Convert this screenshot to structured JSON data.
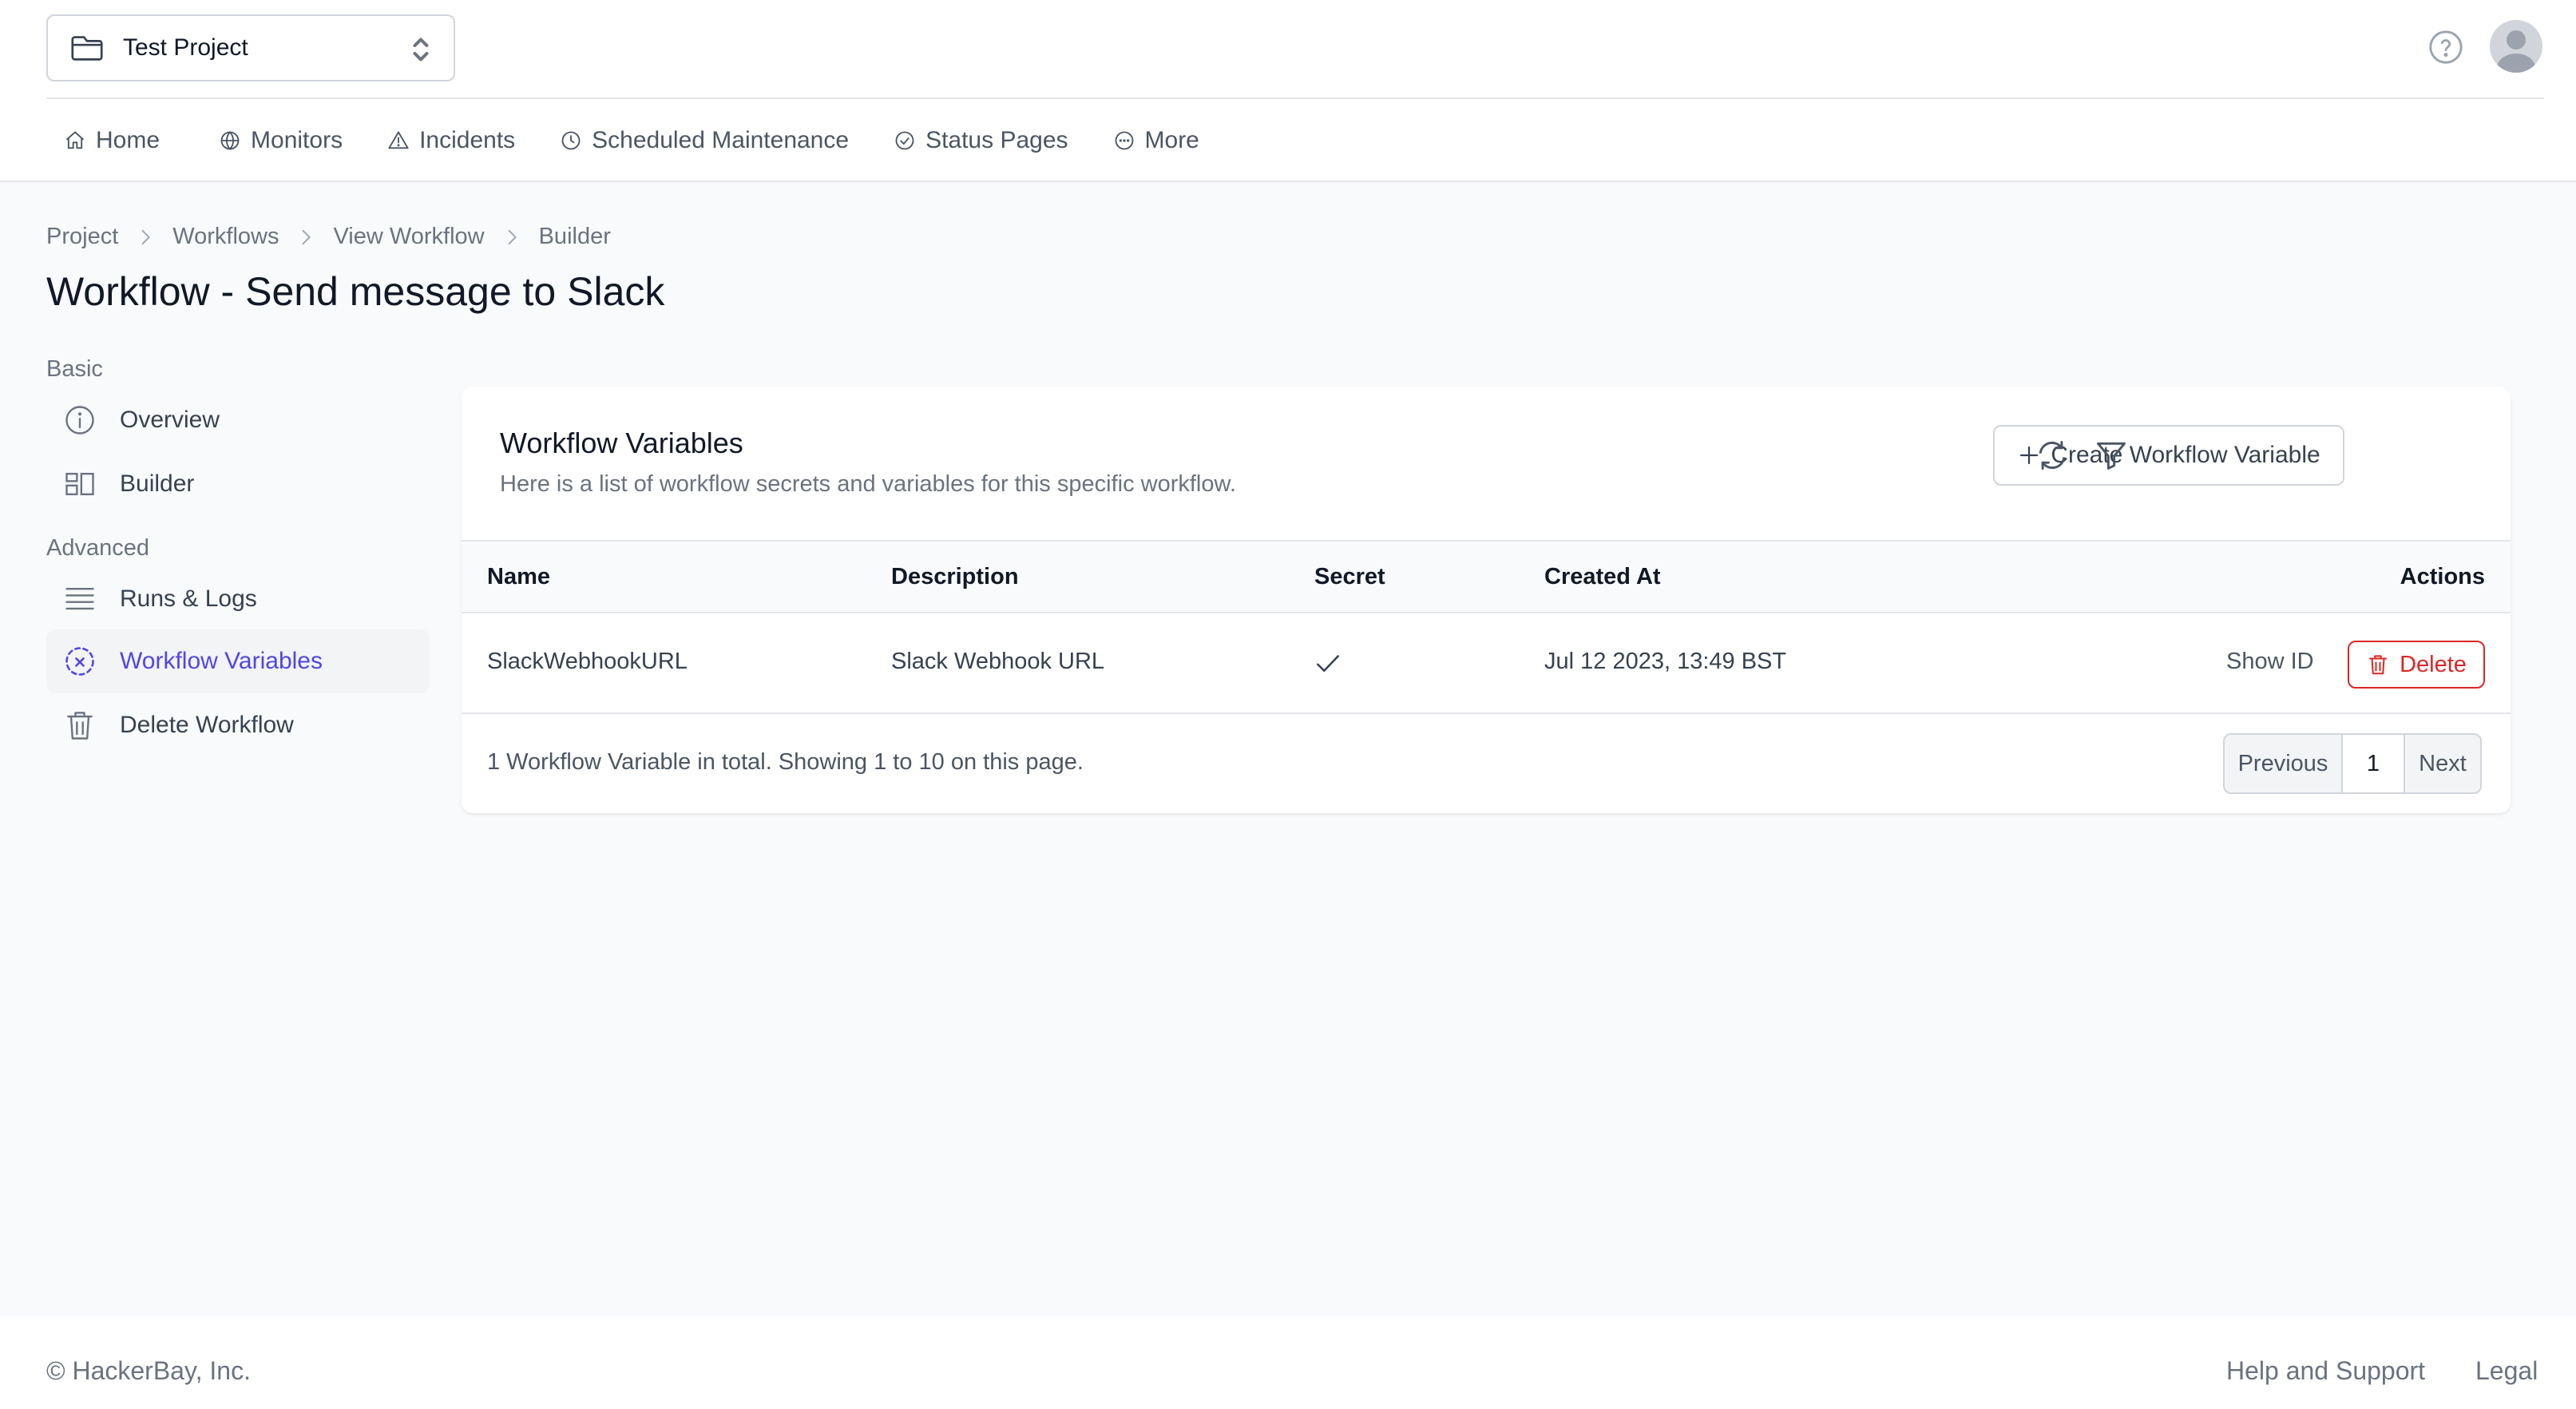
{
  "header": {
    "project_name": "Test Project",
    "nav": [
      {
        "label": "Home",
        "icon": "home-icon"
      },
      {
        "label": "Monitors",
        "icon": "globe-icon"
      },
      {
        "label": "Incidents",
        "icon": "alert-triangle-icon"
      },
      {
        "label": "Scheduled Maintenance",
        "icon": "clock-icon"
      },
      {
        "label": "Status Pages",
        "icon": "check-circle-icon"
      },
      {
        "label": "More",
        "icon": "more-circle-icon"
      }
    ]
  },
  "breadcrumb": [
    "Project",
    "Workflows",
    "View Workflow",
    "Builder"
  ],
  "page_title": "Workflow - Send message to Slack",
  "side_menu": {
    "basic_label": "Basic",
    "advanced_label": "Advanced",
    "items": [
      {
        "label": "Overview",
        "icon": "info-icon"
      },
      {
        "label": "Builder",
        "icon": "builder-icon"
      },
      {
        "label": "Runs & Logs",
        "icon": "list-icon"
      },
      {
        "label": "Workflow Variables",
        "icon": "variable-icon",
        "active": true
      },
      {
        "label": "Delete Workflow",
        "icon": "trash-icon"
      }
    ]
  },
  "card": {
    "title": "Workflow Variables",
    "description": "Here is a list of workflow secrets and variables for this specific workflow.",
    "create_button": "Create Workflow Variable",
    "columns": [
      "Name",
      "Description",
      "Secret",
      "Created At",
      "Actions"
    ],
    "rows": [
      {
        "name": "SlackWebhookURL",
        "description": "Slack Webhook URL",
        "secret": true,
        "created_at": "Jul 12 2023, 13:49 BST",
        "show_id": "Show ID",
        "delete": "Delete"
      }
    ],
    "summary": "1 Workflow Variable in total. Showing 1 to 10 on this page.",
    "pagination": {
      "previous": "Previous",
      "page": "1",
      "next": "Next"
    }
  },
  "footer": {
    "copyright": "© HackerBay, Inc.",
    "links": [
      "Help and Support",
      "Legal"
    ]
  },
  "colors": {
    "accent": "#4f46e5",
    "danger": "#dc2626",
    "background": "#f9fafb"
  }
}
